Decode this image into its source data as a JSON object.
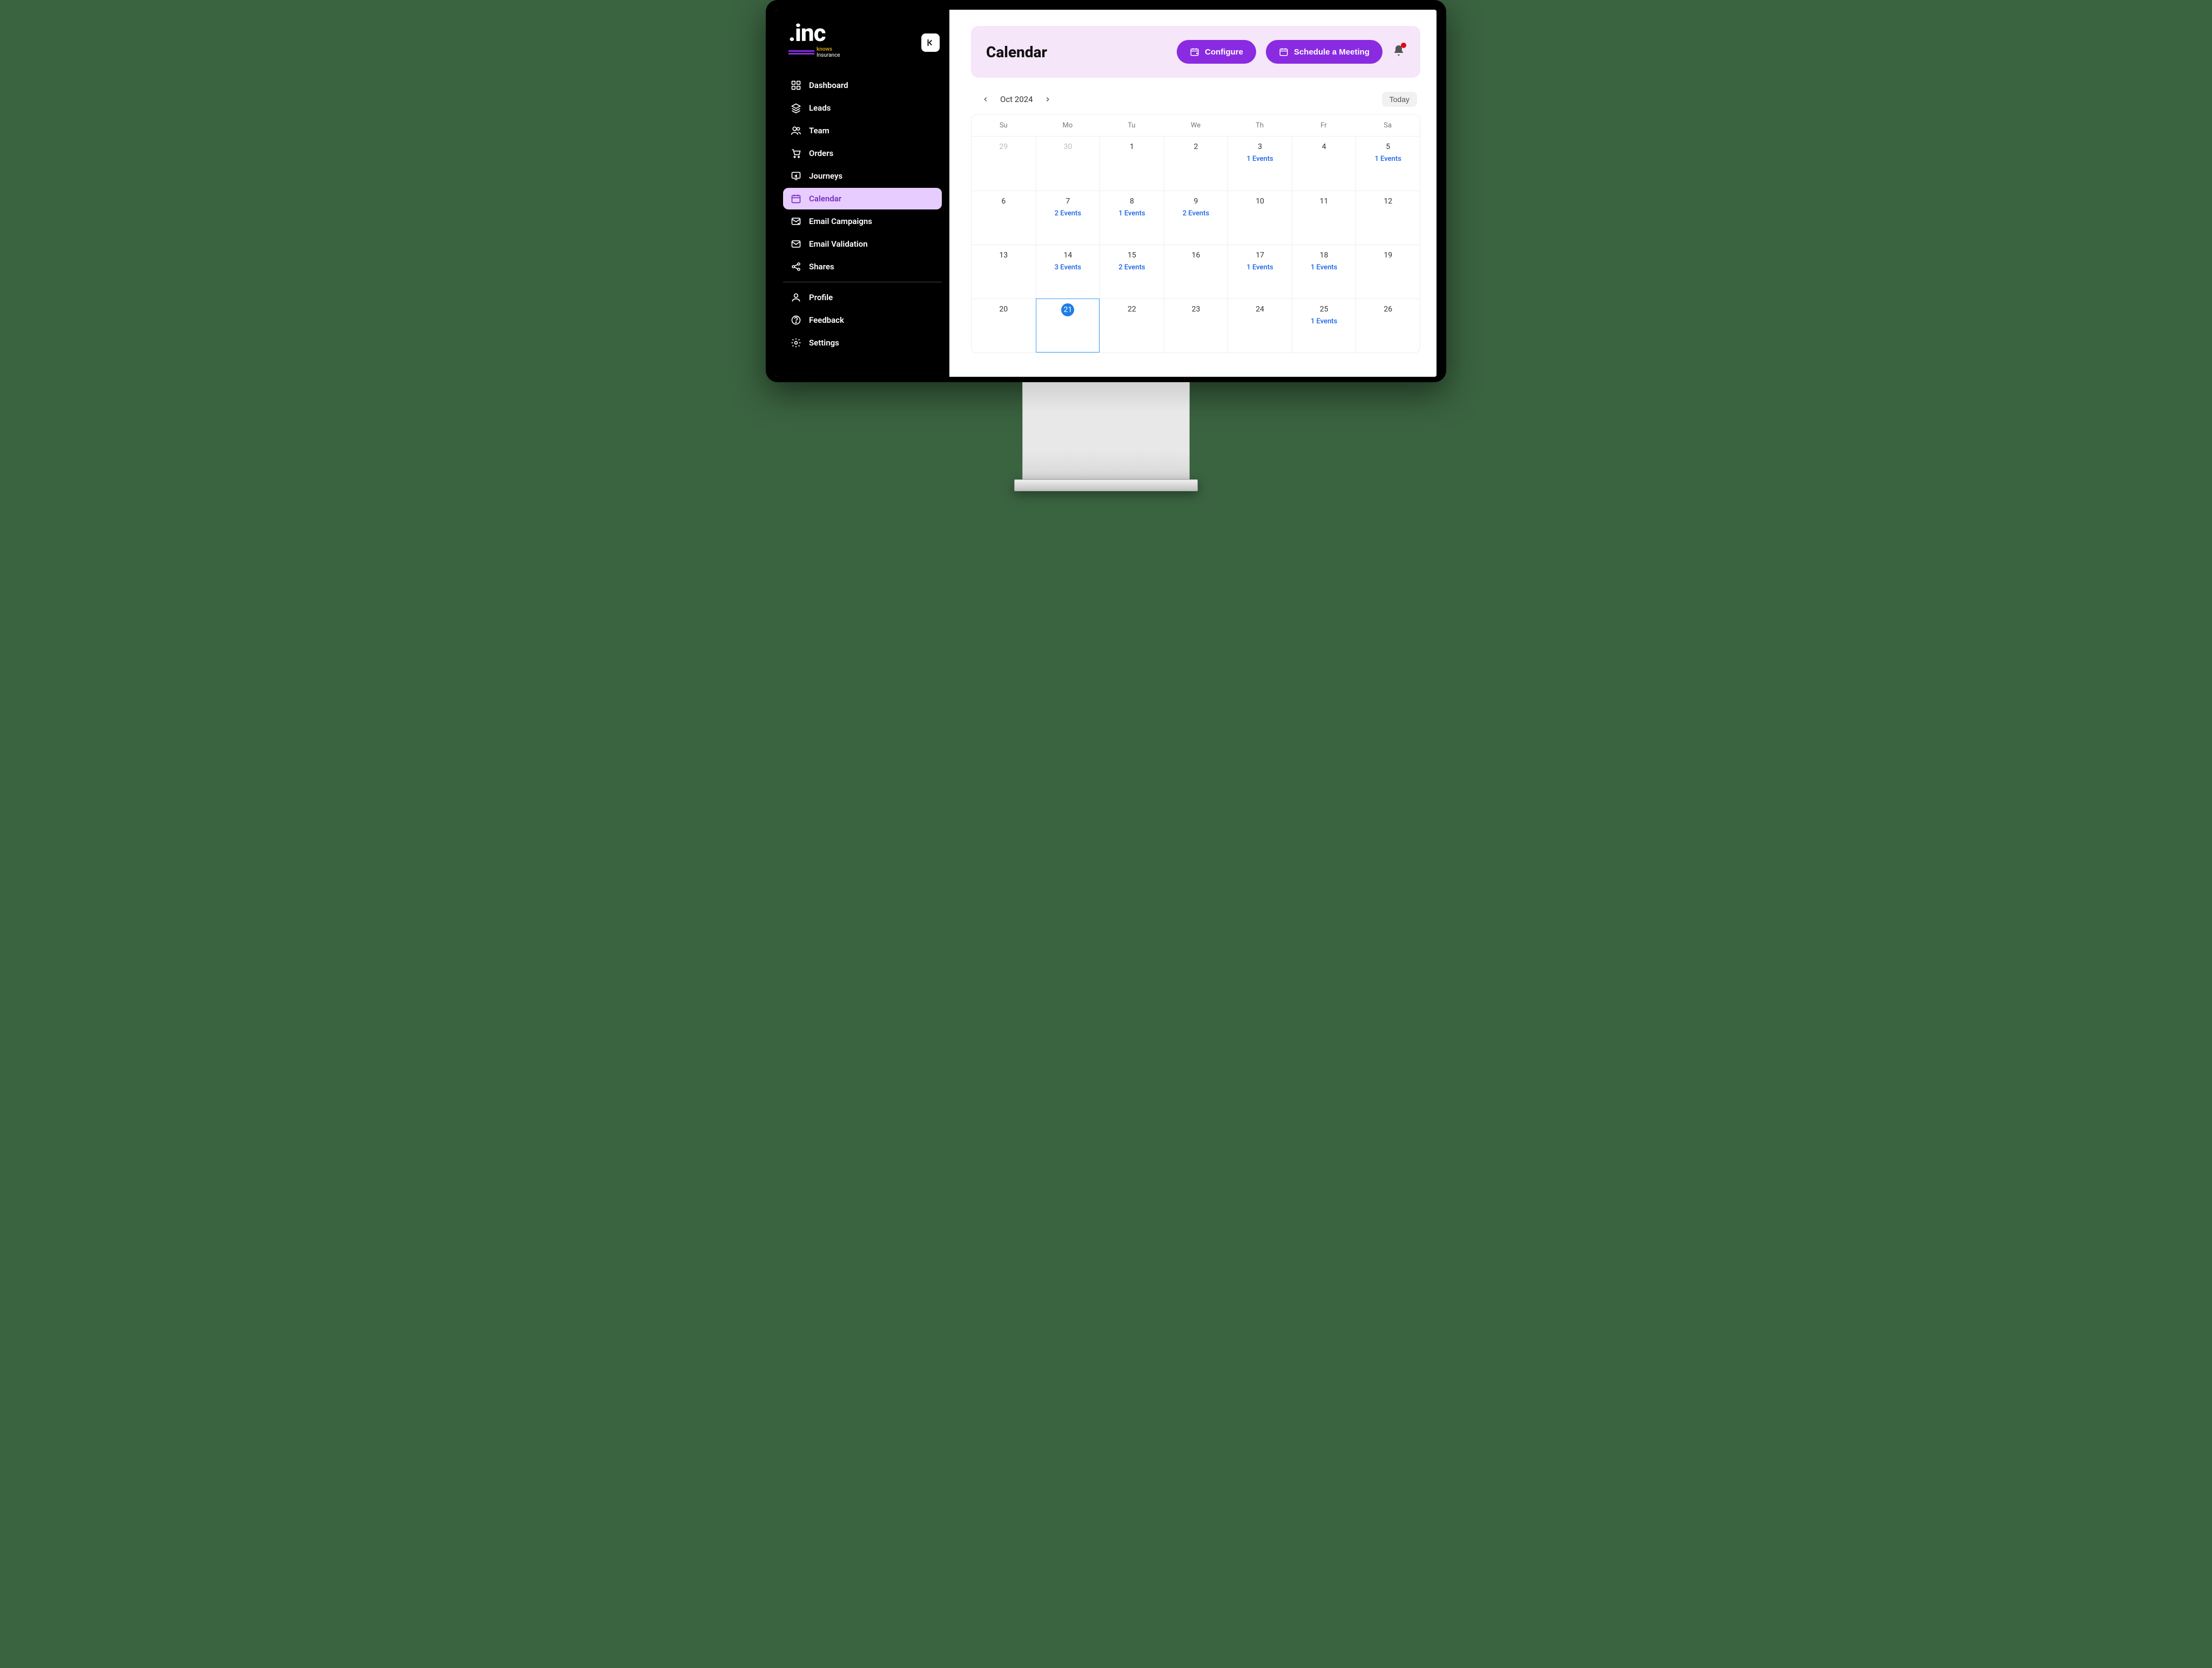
{
  "brand": {
    "name": ".inc",
    "tag1": "knows",
    "tag2": "Insurance"
  },
  "sidebar": {
    "items": [
      {
        "label": "Dashboard",
        "icon": "dashboard"
      },
      {
        "label": "Leads",
        "icon": "layers"
      },
      {
        "label": "Team",
        "icon": "team"
      },
      {
        "label": "Orders",
        "icon": "cart"
      },
      {
        "label": "Journeys",
        "icon": "monitor"
      },
      {
        "label": "Calendar",
        "icon": "calendar",
        "active": true
      },
      {
        "label": "Email Campaigns",
        "icon": "mail-send"
      },
      {
        "label": "Email Validation",
        "icon": "mail"
      },
      {
        "label": "Shares",
        "icon": "share"
      }
    ],
    "account_items": [
      {
        "label": "Profile",
        "icon": "user"
      },
      {
        "label": "Feedback",
        "icon": "help"
      },
      {
        "label": "Settings",
        "icon": "settings"
      }
    ]
  },
  "header": {
    "title": "Calendar",
    "configure": "Configure",
    "schedule": "Schedule a Meeting"
  },
  "calendar": {
    "month_label": "Oct 2024",
    "today_label": "Today",
    "weekdays": [
      "Su",
      "Mo",
      "Tu",
      "We",
      "Th",
      "Fr",
      "Sa"
    ],
    "weeks": [
      [
        {
          "day": 29,
          "other": true
        },
        {
          "day": 30,
          "other": true
        },
        {
          "day": 1
        },
        {
          "day": 2
        },
        {
          "day": 3,
          "events": "1 Events"
        },
        {
          "day": 4
        },
        {
          "day": 5,
          "events": "1 Events"
        }
      ],
      [
        {
          "day": 6
        },
        {
          "day": 7,
          "events": "2 Events"
        },
        {
          "day": 8,
          "events": "1 Events"
        },
        {
          "day": 9,
          "events": "2 Events"
        },
        {
          "day": 10
        },
        {
          "day": 11
        },
        {
          "day": 12
        }
      ],
      [
        {
          "day": 13
        },
        {
          "day": 14,
          "events": "3 Events"
        },
        {
          "day": 15,
          "events": "2 Events"
        },
        {
          "day": 16
        },
        {
          "day": 17,
          "events": "1 Events"
        },
        {
          "day": 18,
          "events": "1 Events"
        },
        {
          "day": 19
        }
      ],
      [
        {
          "day": 20
        },
        {
          "day": 21,
          "today": true
        },
        {
          "day": 22
        },
        {
          "day": 23
        },
        {
          "day": 24
        },
        {
          "day": 25,
          "events": "1 Events"
        },
        {
          "day": 26
        }
      ]
    ]
  }
}
